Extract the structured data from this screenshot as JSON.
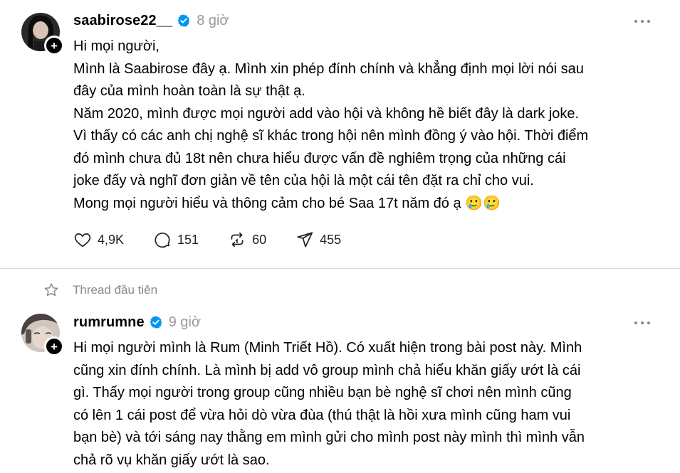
{
  "posts": [
    {
      "username": "saabirose22__",
      "time": "8 giờ",
      "lines": [
        "Hi mọi người,",
        "Mình là Saabirose đây ạ. Mình xin phép đính chính và khẳng định mọi lời nói sau",
        "đây của mình hoàn toàn là sự thật ạ.",
        "Năm 2020, mình được mọi người add vào hội và không hề biết đây là dark joke.",
        "Vì thấy có các anh chị nghệ sĩ khác trong hội nên mình đồng ý vào hội. Thời điểm",
        "đó mình chưa đủ 18t nên chưa hiểu được vấn đề nghiêm trọng của những cái",
        "joke đấy và nghĩ đơn giản về tên của hội là một cái tên đặt ra chỉ cho vui.",
        "Mong mọi người hiểu và thông cảm cho bé Saa 17t năm đó ạ 🥲🥲"
      ],
      "likes": "4,9K",
      "comments": "151",
      "reposts": "60",
      "shares": "455"
    },
    {
      "username": "rumrumne",
      "time": "9 giờ",
      "lines": [
        "Hi mọi người mình là Rum (Minh Triết Hồ). Có xuất hiện trong bài post này. Mình",
        "cũng xin đính chính. Là mình bị add vô group mình chả hiểu khăn giấy ướt là cái",
        "gì. Thấy mọi người trong group cũng nhiều bạn bè nghệ sĩ chơi nên mình cũng",
        "có lên 1 cái post để vừa hỏi dò vừa đùa (thú thật là hồi xưa mình cũng ham vui",
        "bạn bè) và tới sáng nay thằng em mình gửi cho mình post này mình thì mình vẫn",
        "chả rõ vụ khăn giấy ướt là sao."
      ]
    }
  ],
  "thread_label": "Thread đầu tiên",
  "follow_symbol": "+",
  "colors": {
    "verified": "#0095f6",
    "muted": "#999999",
    "divider": "#d9d9d9"
  },
  "icons": [
    "heart-icon",
    "comment-icon",
    "repost-icon",
    "share-icon",
    "star-icon",
    "verified-badge-icon",
    "more-icon"
  ]
}
